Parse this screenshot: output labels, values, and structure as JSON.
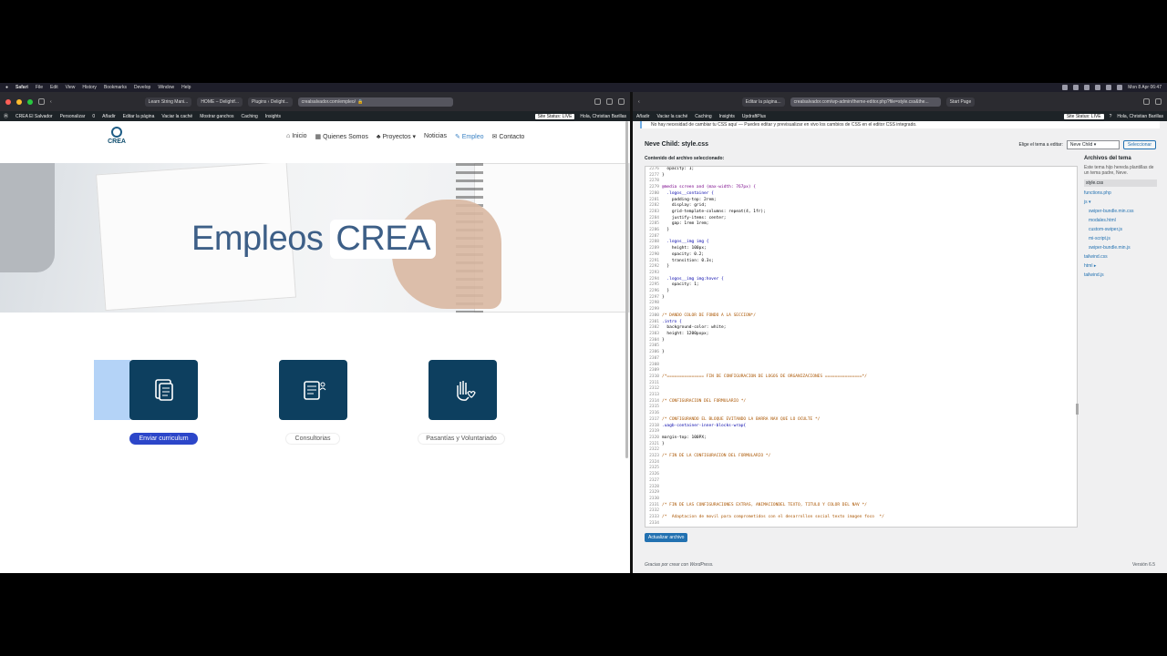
{
  "menubar": {
    "app": "Safari",
    "items": [
      "File",
      "Edit",
      "View",
      "History",
      "Bookmarks",
      "Develop",
      "Window",
      "Help"
    ],
    "clock": "Mon 8 Apr 06:47"
  },
  "left": {
    "tabs": [
      "Learn String Mani...",
      "HOME – Delightf...",
      "Plugins ‹ Delight...",
      "crealsalvador.com/empleo/"
    ],
    "wpbar": {
      "items": [
        "CREA El Salvador",
        "Personalizar",
        "0",
        "Añadir",
        "Editar la página",
        "Vaciar la caché",
        "Mostrar ganchos",
        "Caching",
        "Insights"
      ],
      "status": "Site Status: LIVE",
      "user": "Hola, Christian Barillas"
    },
    "logo": "CREA",
    "nav": [
      "Inicio",
      "Quienes Somos",
      "Proyectos",
      "Noticias",
      "Empleo",
      "Contacto"
    ],
    "hero": {
      "word1": "Empleos",
      "word2": "CREA"
    },
    "buttons": [
      "Enviar curriculum",
      "Consultorias",
      "Pasantías y Voluntariado"
    ]
  },
  "right": {
    "tabs": [
      "Editar la página...",
      "crealsalvador.com/wp-admin/theme-editor.php?file=style.css&the...",
      "Start Page"
    ],
    "wpbar": {
      "items": [
        "Añadir",
        "Vaciar la caché",
        "Caching",
        "Insights",
        "UpdraftPlus"
      ],
      "status": "Site Status: LIVE",
      "user": "Hola, Christian Barillas"
    },
    "notice": "No hay necesidad de cambiar tu CSS aquí — Puedes editar y previsualizar en vivo los cambios de CSS en el editor CSS integrado.",
    "file_title": "Neve Child: style.css",
    "theme_label": "Elige el tema a editar:",
    "theme_value": "Neve Child",
    "select_btn": "Seleccionar",
    "content_label": "Contenido del archivo seleccionado:",
    "update_btn": "Actualizar archivo",
    "footer_left": "Gracias por crear con WordPress.",
    "footer_right": "Versión 6.5",
    "sidebar": {
      "title": "Archivos del tema",
      "desc": "Este tema hijo hereda plantillas de un tema padre, Neve.",
      "files": [
        "style.css",
        "functions.php",
        "js ▾",
        "swiper-bundle.min.css",
        "modales.html",
        "custom-swiper.js",
        "mi-script.js",
        "swiper-bundle.min.js",
        "tailwind.css",
        "html ▸",
        "tailwind.js"
      ]
    },
    "code": [
      [
        "2276",
        "  opacity: 1;"
      ],
      [
        "2277",
        "}"
      ],
      [
        "2278",
        ""
      ],
      [
        "2279",
        "@media screen and (max-width: 767px) {"
      ],
      [
        "2280",
        "  .logos__container {"
      ],
      [
        "2281",
        "    padding-top: 2rem;"
      ],
      [
        "2282",
        "    display: grid;"
      ],
      [
        "2283",
        "    grid-template-columns: repeat(4, 1fr);"
      ],
      [
        "2284",
        "    justify-items: center;"
      ],
      [
        "2285",
        "    gap: 1rem 1rem;"
      ],
      [
        "2286",
        "  }"
      ],
      [
        "2287",
        ""
      ],
      [
        "2288",
        "  .logos__img img {"
      ],
      [
        "2289",
        "    height: 100px;"
      ],
      [
        "2290",
        "    opacity: 0.2;"
      ],
      [
        "2291",
        "    transition: 0.3s;"
      ],
      [
        "2292",
        "  }"
      ],
      [
        "2293",
        ""
      ],
      [
        "2294",
        "  .logos__img img:hover {"
      ],
      [
        "2295",
        "    opacity: 1;"
      ],
      [
        "2296",
        "  }"
      ],
      [
        "2297",
        "}"
      ],
      [
        "2298",
        ""
      ],
      [
        "2299",
        ""
      ],
      [
        "2300",
        "/* DANDO COLOR DE FONDO A LA SECCION*/"
      ],
      [
        "2301",
        ".intro {"
      ],
      [
        "2302",
        "  background-color: white;"
      ],
      [
        "2303",
        "  height: 1200pxpx;"
      ],
      [
        "2304",
        "}"
      ],
      [
        "2305",
        ""
      ],
      [
        "2306",
        "}"
      ],
      [
        "2307",
        ""
      ],
      [
        "2308",
        ""
      ],
      [
        "2309",
        ""
      ],
      [
        "2310",
        "/*=============== FIN DE CONFIGURACION DE LOGOS DE ORGANIZACIONES ===============*/"
      ],
      [
        "2311",
        ""
      ],
      [
        "2312",
        ""
      ],
      [
        "2313",
        ""
      ],
      [
        "2314",
        "/* CONFIGURACION DEL FORMULARIO */"
      ],
      [
        "2315",
        ""
      ],
      [
        "2316",
        ""
      ],
      [
        "2317",
        "/* CONFIGURANDO EL BLOQUE EVITANDO LA BARRA NAV QUE LO OCULTE */"
      ],
      [
        "2318",
        ".uagb-container-inner-blocks-wrap{"
      ],
      [
        "2319",
        ""
      ],
      [
        "2320",
        "margin-top: 100PX;"
      ],
      [
        "2321",
        "}"
      ],
      [
        "2322",
        ""
      ],
      [
        "2323",
        "/* FIN DE LA CONFIGURACION DEL FORMULARIO */"
      ],
      [
        "2324",
        ""
      ],
      [
        "2325",
        ""
      ],
      [
        "2326",
        ""
      ],
      [
        "2327",
        ""
      ],
      [
        "2328",
        ""
      ],
      [
        "2329",
        ""
      ],
      [
        "2330",
        ""
      ],
      [
        "2331",
        "/* FIN DE LAS CONFIGURACIONES EXTRAS, ANIMACIONDEL TEXTO, TITULO Y COLOR DEL NAV */"
      ],
      [
        "2332",
        ""
      ],
      [
        "2333",
        "/*  Adaptacion de movil para comprometidos con el desarrollon social texto imagen foco  */"
      ],
      [
        "2334",
        ""
      ]
    ]
  }
}
